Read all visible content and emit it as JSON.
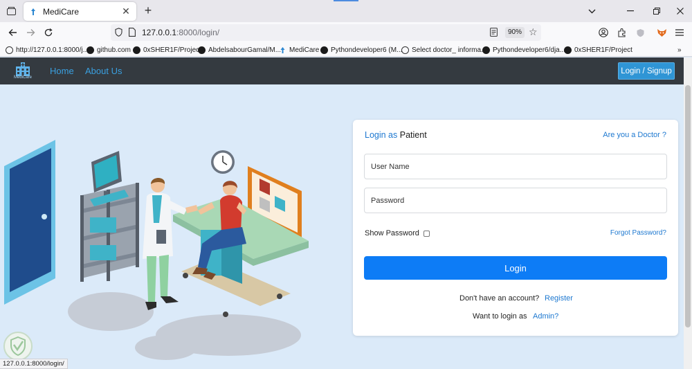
{
  "browser": {
    "tab_title": "MediCare",
    "url_host": "127.0.0.1",
    "url_rest": ":8000/login/",
    "zoom": "90%",
    "status_url": "127.0.0.1:8000/login/"
  },
  "bookmarks": [
    {
      "icon": "globe-icon",
      "label": "http://127.0.0.1:8000/j..."
    },
    {
      "icon": "github-icon",
      "label": "github.com"
    },
    {
      "icon": "github-icon",
      "label": "0xSHER1F/Project"
    },
    {
      "icon": "github-icon",
      "label": "AbdelsabourGamal/M..."
    },
    {
      "icon": "medicare-icon",
      "label": "MediCare"
    },
    {
      "icon": "github-icon",
      "label": "Pythondeveloper6 (M..."
    },
    {
      "icon": "globe-icon",
      "label": "Select doctor_ informa..."
    },
    {
      "icon": "github-icon",
      "label": "Pythondeveloper6/dja..."
    },
    {
      "icon": "github-icon",
      "label": "0xSHER1F/Project"
    }
  ],
  "site": {
    "brand": "MediCare",
    "nav": [
      "Home",
      "About Us"
    ],
    "login_signup": "Login / Signup"
  },
  "login": {
    "title_prefix": "Login as",
    "title_role": "Patient",
    "doctor_link": "Are you a Doctor ?",
    "username_placeholder": "User Name",
    "password_placeholder": "Password",
    "show_password": "Show Password",
    "forgot_password": "Forgot Password?",
    "login_button": "Login",
    "no_account": "Don't have an account?",
    "register": "Register",
    "login_as": "Want to login as",
    "admin": "Admin?"
  },
  "colors": {
    "nav_bg": "#343a40",
    "link": "#1d78d0",
    "primary": "#0d7cf6",
    "page_bg": "#dbeaf9"
  }
}
